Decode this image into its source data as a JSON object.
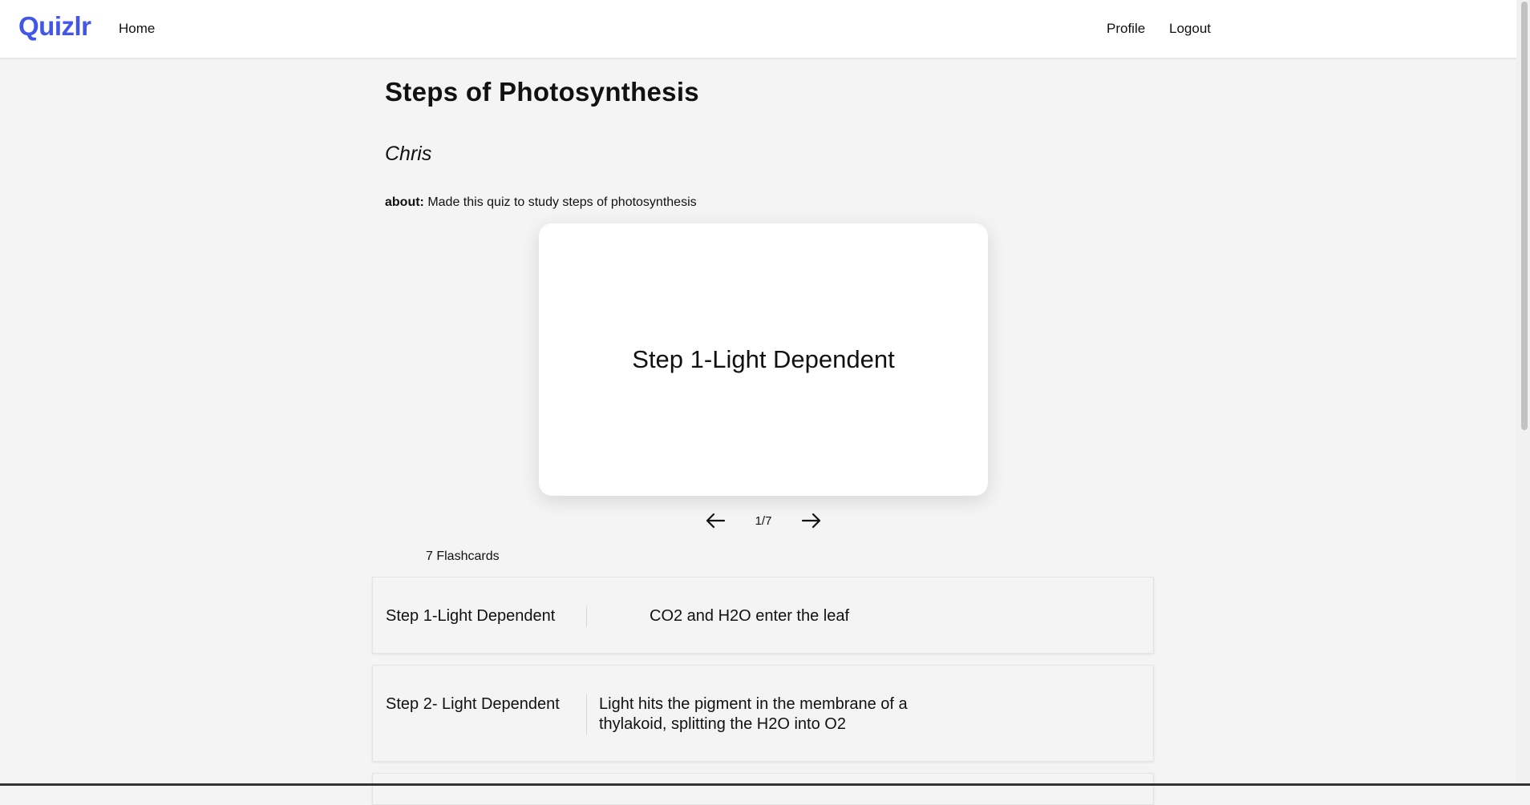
{
  "nav": {
    "brand": "Quizlr",
    "home": "Home",
    "profile": "Profile",
    "logout": "Logout"
  },
  "quiz": {
    "title": "Steps of Photosynthesis",
    "author": "Chris",
    "about_label": "about:",
    "about_text": "Made this quiz to study steps of photosynthesis"
  },
  "card": {
    "current_text": "Step 1-Light Dependent",
    "counter": "1/7",
    "prev_icon": "arrow-left-icon",
    "next_icon": "arrow-right-icon"
  },
  "list": {
    "count_label": "7 Flashcards",
    "items": [
      {
        "term": "Step 1-Light Dependent",
        "definition": "CO2 and H2O enter the leaf"
      },
      {
        "term": "Step 2- Light Dependent",
        "definition": "Light hits the pigment in the membrane of a thylakoid, splitting the H2O into O2"
      }
    ]
  },
  "colors": {
    "brand": "#4257e8",
    "background": "#f4f4f4",
    "card": "#ffffff"
  }
}
